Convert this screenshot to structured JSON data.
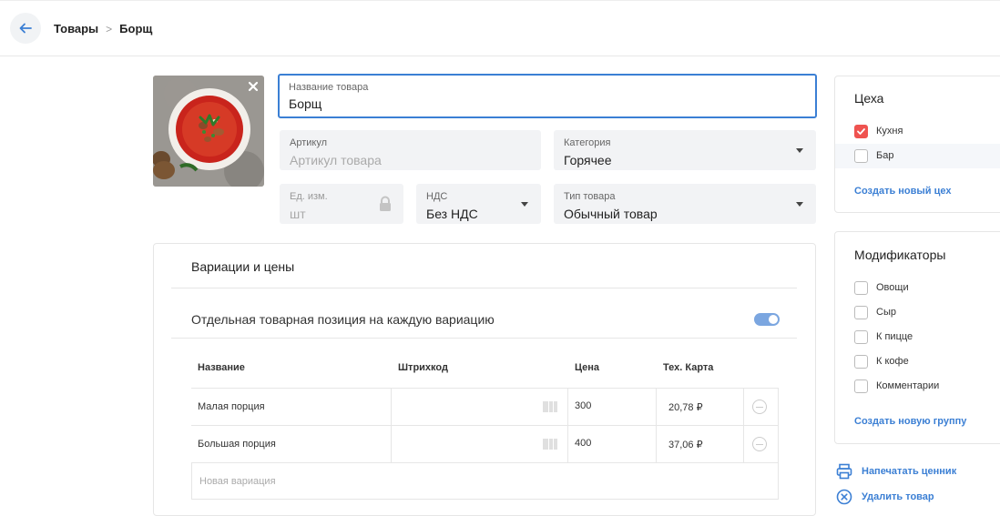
{
  "breadcrumb": {
    "parent": "Товары",
    "separator": ">",
    "current": "Борщ"
  },
  "form": {
    "name": {
      "label": "Название товара",
      "value": "Борщ"
    },
    "sku": {
      "label": "Артикул",
      "placeholder": "Артикул товара"
    },
    "category": {
      "label": "Категория",
      "value": "Горячее"
    },
    "unit": {
      "label": "Ед. изм.",
      "value": "шт"
    },
    "vat": {
      "label": "НДС",
      "value": "Без НДС"
    },
    "product_type": {
      "label": "Тип товара",
      "value": "Обычный товар"
    }
  },
  "variations": {
    "title": "Вариации и цены",
    "toggle_label": "Отдельная товарная позиция на каждую вариацию",
    "toggle_on": true,
    "columns": [
      "Название",
      "Штрихкод",
      "Цена",
      "Тех. Карта"
    ],
    "rows": [
      {
        "name": "Малая порция",
        "barcode": "",
        "price": "300",
        "tech_card": "20,78 ₽"
      },
      {
        "name": "Большая порция",
        "barcode": "",
        "price": "400",
        "tech_card": "37,06 ₽"
      }
    ],
    "new_placeholder": "Новая вариация"
  },
  "workshops": {
    "title": "Цеха",
    "items": [
      {
        "label": "Кухня",
        "checked": true
      },
      {
        "label": "Бар",
        "checked": false
      }
    ],
    "create_link": "Создать новый цех"
  },
  "modifiers": {
    "title": "Модификаторы",
    "items": [
      {
        "label": "Овощи",
        "checked": false
      },
      {
        "label": "Сыр",
        "checked": false
      },
      {
        "label": "К пицце",
        "checked": false
      },
      {
        "label": "К кофе",
        "checked": false
      },
      {
        "label": "Комментарии",
        "checked": false
      }
    ],
    "create_link": "Создать новую группу"
  },
  "actions": {
    "print_label": "Напечатать ценник",
    "delete_label": "Удалить товар"
  },
  "colors": {
    "accent": "#3b7fd4",
    "checked": "#ef5350",
    "field_bg": "#f2f3f5"
  },
  "icons": [
    "arrow-left-icon",
    "close-icon",
    "lock-icon",
    "chevron-down-icon",
    "barcode-icon",
    "minus-circle-icon",
    "check-icon",
    "printer-icon",
    "close-circle-icon"
  ]
}
